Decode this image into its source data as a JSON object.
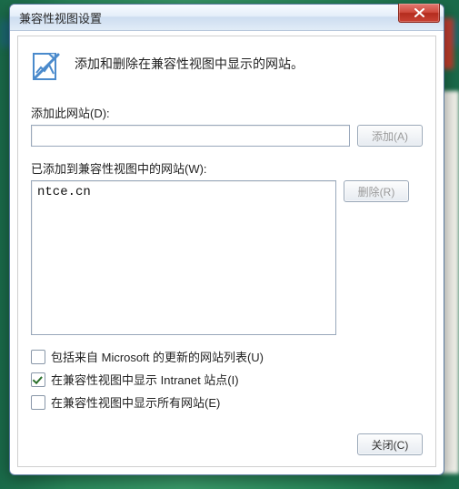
{
  "window": {
    "title": "兼容性视图设置"
  },
  "intro": {
    "text": "添加和删除在兼容性视图中显示的网站。"
  },
  "add": {
    "label": "添加此网站(D):",
    "value": "",
    "button": "添加(A)"
  },
  "list": {
    "label": "已添加到兼容性视图中的网站(W):",
    "items": [
      "ntce.cn"
    ],
    "remove_button": "删除(R)"
  },
  "checks": {
    "ms_list": {
      "label": "包括来自 Microsoft 的更新的网站列表(U)",
      "checked": false
    },
    "intranet": {
      "label": "在兼容性视图中显示 Intranet 站点(I)",
      "checked": true
    },
    "all_sites": {
      "label": "在兼容性视图中显示所有网站(E)",
      "checked": false
    }
  },
  "footer": {
    "close_button": "关闭(C)"
  }
}
